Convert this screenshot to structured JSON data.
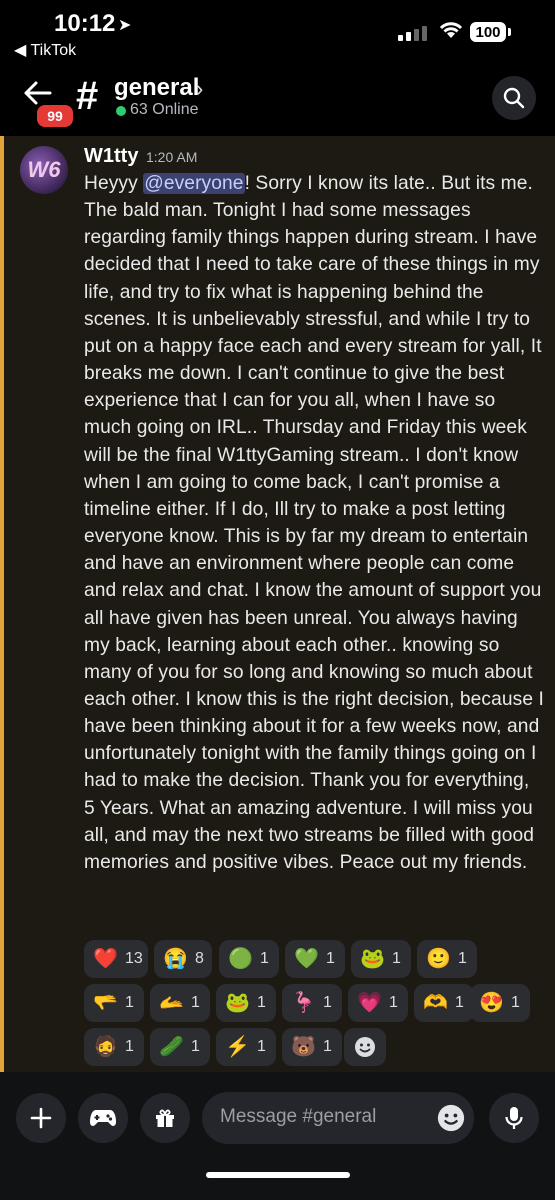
{
  "status": {
    "time": "10:12",
    "back_app": "◀ TikTok",
    "battery": "100"
  },
  "header": {
    "unread_count": "99",
    "channel_name": "general",
    "online": "63 Online"
  },
  "message": {
    "avatar_text": "W6",
    "author": "W1tty",
    "time": "1:20 AM",
    "prefix": "Heyyy ",
    "mention": "@everyone",
    "body": "! Sorry I know its late.. But its me. The bald man. Tonight I had some messages regarding family things happen during stream. I have decided that I need to take care of these things in my life, and try to fix what is happening behind the scenes. It is unbelievably stressful, and while I try to put on a happy face each and every stream for yall, It breaks me down. I can't continue to give the best experience that I can for you all, when I have so much going on IRL.. Thursday and Friday this week will be the final W1ttyGaming stream.. I don't know when I am going to come back, I can't promise a timeline either. If I do, Ill try to make a post letting everyone know. This is by far my dream to entertain and have an environment where people can come and relax and chat. I know the amount of support you all have given has been unreal. You always having my back, learning about each other.. knowing so many of you for so long and knowing so much about each other. I know this is the right decision, because I have been thinking about it for a few weeks now, and unfortunately tonight with the family things going on I had to make the decision. Thank you for everything, 5 Years. What an amazing adventure. I will miss you all, and may the next two streams be filled with good memories and positive vibes. Peace out my friends."
  },
  "reactions": [
    {
      "emoji": "❤️",
      "count": "13"
    },
    {
      "emoji": "😭",
      "count": "8"
    },
    {
      "emoji": "🟢",
      "count": "1"
    },
    {
      "emoji": "💚",
      "count": "1"
    },
    {
      "emoji": "🐸",
      "count": "1"
    },
    {
      "emoji": "🙂",
      "count": "1"
    },
    {
      "emoji": "🫳",
      "count": "1"
    },
    {
      "emoji": "🫴",
      "count": "1"
    },
    {
      "emoji": "🐸",
      "count": "1"
    },
    {
      "emoji": "🦩",
      "count": "1"
    },
    {
      "emoji": "💗",
      "count": "1"
    },
    {
      "emoji": "🫶",
      "count": "1"
    },
    {
      "emoji": "😍",
      "count": "1"
    },
    {
      "emoji": "🧔",
      "count": "1"
    },
    {
      "emoji": "🥒",
      "count": "1"
    },
    {
      "emoji": "⚡",
      "count": "1"
    },
    {
      "emoji": "🐻",
      "count": "1"
    }
  ],
  "composer": {
    "placeholder": "Message #general"
  },
  "icons": [
    "back-arrow-icon",
    "hash-icon",
    "search-icon",
    "plus-icon",
    "gamepad-icon",
    "gift-icon",
    "emoji-icon",
    "microphone-icon",
    "add-reaction-icon"
  ],
  "colors": {
    "accent_bar": "#e3a33b",
    "online": "#2ecc71",
    "badge": "#e53935"
  }
}
